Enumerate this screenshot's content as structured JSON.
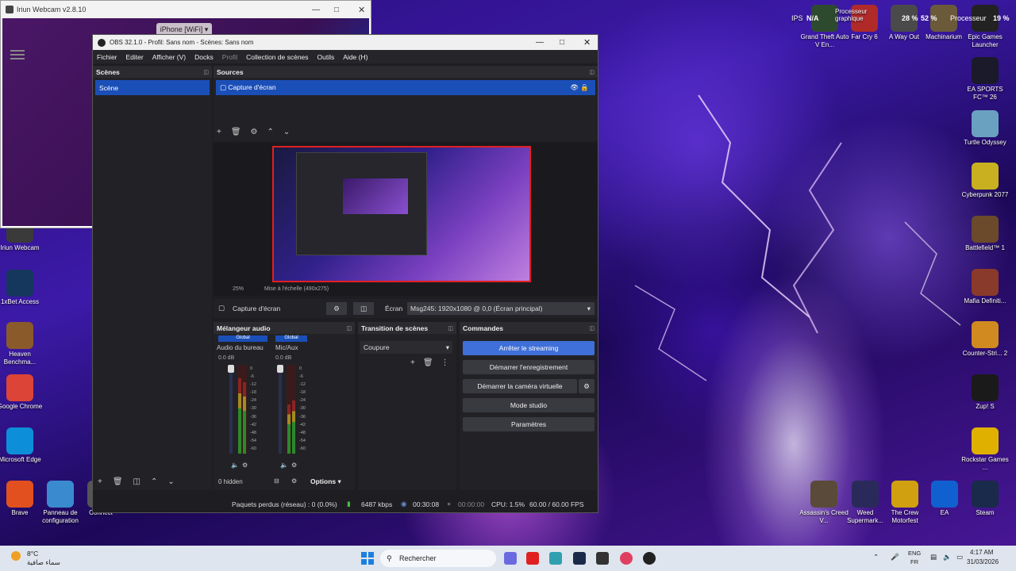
{
  "desktop_left_icons": [
    {
      "label": "Iriun Webcam",
      "icon": "webcam-icon",
      "color": "#3a3a3a"
    },
    {
      "label": "1xBet Access",
      "icon": "1x-icon",
      "color": "#15375e"
    },
    {
      "label": "Heaven Benchma...",
      "icon": "heaven-icon",
      "color": "#8a5a2a"
    },
    {
      "label": "Google Chrome",
      "icon": "chrome-icon",
      "color": "#db4437"
    },
    {
      "label": "Microsoft Edge",
      "icon": "edge-icon",
      "color": "#0c8fd8"
    },
    {
      "label": "Brave",
      "icon": "brave-icon",
      "color": "#e25020"
    },
    {
      "label": "Panneau de configuration",
      "icon": "control-panel-icon",
      "color": "#3a8ad0"
    },
    {
      "label": "Connect",
      "icon": "connect-icon",
      "color": "#555"
    }
  ],
  "desktop_top_icons": [
    {
      "label": "Grand Theft Auto V En...",
      "color": "#2e4a2e"
    },
    {
      "label": "Far Cry 6",
      "color": "#b02a2a"
    },
    {
      "label": "A Way Out",
      "color": "#4a4a4a"
    },
    {
      "label": "Machinarium",
      "color": "#6a5a3a"
    },
    {
      "label": "Epic Games Launcher",
      "color": "#222"
    }
  ],
  "desktop_right_icons": [
    {
      "label": "EA SPORTS FC™ 26",
      "color": "#1a1a2a"
    },
    {
      "label": "Turtle Odyssey",
      "color": "#6aa0c0"
    },
    {
      "label": "Cyberpunk 2077",
      "color": "#c8b020"
    },
    {
      "label": "Battlefield™ 1",
      "color": "#6a4a2a"
    },
    {
      "label": "Mafia Definiti...",
      "color": "#8a3a2a"
    },
    {
      "label": "Counter-Stri... 2",
      "color": "#d08a20"
    },
    {
      "label": "Zup! S",
      "color": "#1a1a1a"
    },
    {
      "label": "Rockstar Games ...",
      "color": "#e0b000"
    }
  ],
  "desktop_bottom_icons": [
    {
      "label": "Assassin's Creed V...",
      "color": "#5a4a3a"
    },
    {
      "label": "Weed Supermark...",
      "color": "#2a2a5a"
    },
    {
      "label": "The Crew Motorfest",
      "color": "#d0a010"
    },
    {
      "label": "EA",
      "color": "#1060d0"
    },
    {
      "label": "Steam",
      "color": "#1a2a4a"
    }
  ],
  "overlay_stats": {
    "ips": "IPS",
    "na": "N/A",
    "gpu_label": "Processeur graphique",
    "gpu_pct": "28 %",
    "cpu_pct": "52 %",
    "cpu_label": "Processeur",
    "pct3": "19 %"
  },
  "webcam": {
    "title": "Iriun Webcam v2.8.10",
    "device": "iPhone [WiFi]"
  },
  "obs": {
    "title": "OBS 32.1.0 - Profil: Sans nom - Scènes: Sans nom",
    "menu": [
      "Fichier",
      "Editer",
      "Afficher (V)",
      "Docks",
      "Profil",
      "Collection de scènes",
      "Outils",
      "Aide (H)"
    ],
    "scenes_header": "Scènes",
    "scene_item": "Scène",
    "sources_header": "Sources",
    "source_item": "Capture d'écran",
    "preview_zoom": "25%",
    "preview_scale": "Mise à l'échelle (490x275)",
    "source_bar": {
      "name": "Capture d'écran",
      "screen_label": "Écran",
      "screen_value": "Msg245: 1920x1080 @ 0,0 (Écran principal)"
    },
    "mixer_header": "Mélangeur audio",
    "channels": [
      {
        "tag": "Global",
        "name": "Audio du bureau",
        "db": "0.0 dB"
      },
      {
        "tag": "Global",
        "name": "Mic/Aux",
        "db": "0.0 dB"
      }
    ],
    "scale": [
      "0",
      "-6",
      "-12",
      "-18",
      "-24",
      "-30",
      "-36",
      "-42",
      "-48",
      "-54",
      "-60"
    ],
    "hidden": "0 hidden",
    "options": "Options",
    "transition_header": "Transition de scènes",
    "transition_value": "Coupure",
    "controls_header": "Commandes",
    "controls": [
      "Arrêter le streaming",
      "Démarrer l'enregistrement",
      "Démarrer la caméra virtuelle",
      "Mode studio",
      "Paramètres"
    ],
    "status": {
      "dropped": "Paquets perdus (réseau) : 0 (0.0%)",
      "bitrate": "6487 kbps",
      "stream_time": "00:30:08",
      "rec_time": "00:00:00",
      "cpu": "CPU: 1.5%",
      "fps": "60.00 / 60.00 FPS"
    }
  },
  "taskbar": {
    "temp": "8°C",
    "weather": "سماء صافية",
    "search": "Rechercher",
    "lang1": "ENG",
    "lang2": "FR",
    "time": "4:17 AM",
    "date": "31/03/2026"
  }
}
